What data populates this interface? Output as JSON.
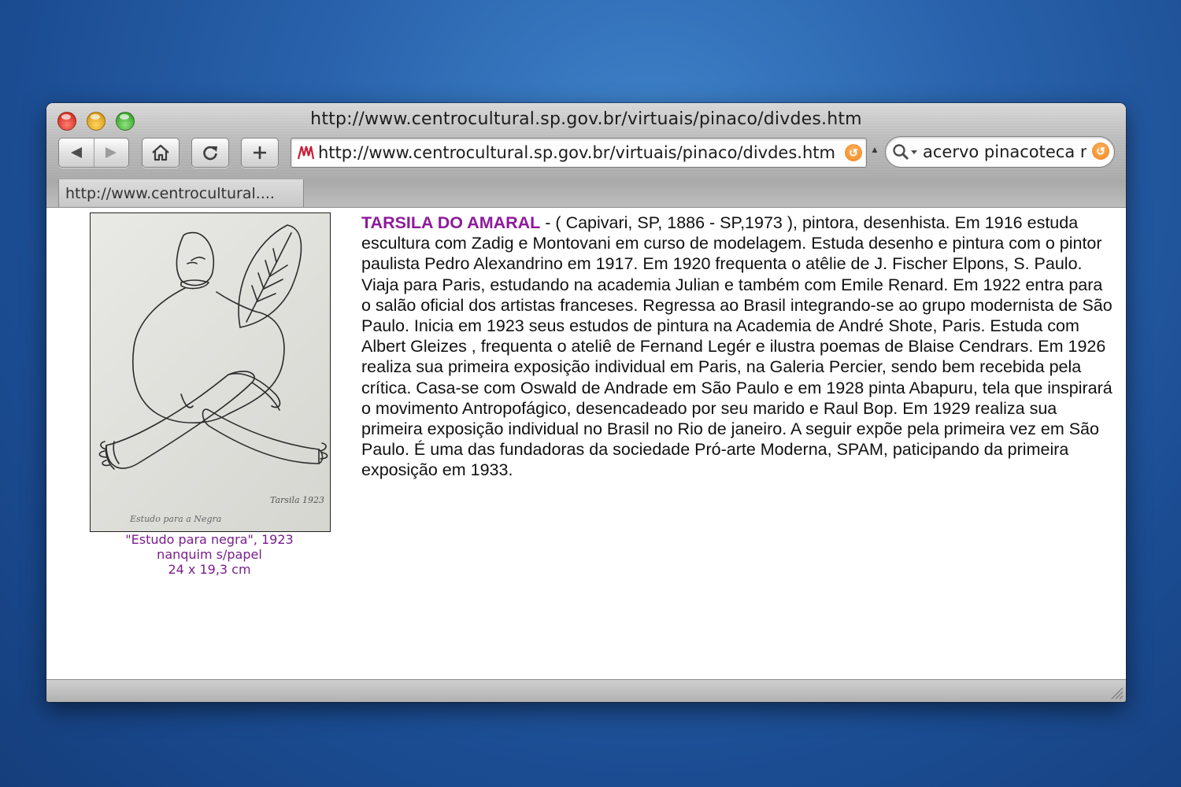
{
  "window": {
    "title": "http://www.centrocultural.sp.gov.br/virtuais/pinaco/divdes.htm"
  },
  "toolbar": {
    "address_value": "http://www.centrocultural.sp.gov.br/virtuais/pinaco/divdes.htm",
    "search_value": "acervo pinacoteca m"
  },
  "tabs": [
    {
      "label": "http://www.centrocultural...."
    }
  ],
  "artwork": {
    "caption_line1": "\"Estudo para negra\", 1923",
    "caption_line2": "nanquim s/papel",
    "caption_line3": "24 x 19,3 cm",
    "inscription_signature": "Tarsila 1923",
    "inscription_title": "Estudo para a Negra"
  },
  "bio": {
    "name": "TARSILA DO AMARAL",
    "text": " - ( Capivari, SP, 1886 - SP,1973 ), pintora, desenhista. Em 1916 estuda escultura com Zadig e Montovani em curso de modelagem. Estuda desenho e pintura com o pintor paulista Pedro Alexandrino em 1917. Em 1920 frequenta o atêlie de J. Fischer Elpons, S. Paulo. Viaja para Paris, estudando na academia Julian e também com Emile Renard. Em 1922 entra para o salão oficial dos artistas franceses. Regressa ao Brasil integrando-se ao grupo modernista de São Paulo. Inicia em 1923 seus estudos de pintura na Academia de André Shote, Paris. Estuda com Albert Gleizes , frequenta o ateliê de Fernand Legér e ilustra poemas de Blaise Cendrars. Em 1926 realiza sua primeira exposição individual em Paris, na Galeria Percier, sendo bem recebida pela crítica. Casa-se com Oswald de Andrade em São Paulo e em 1928 pinta Abapuru, tela que inspirará o movimento Antropofágico, desencadeado por seu marido e Raul Bop. Em 1929 realiza sua primeira exposição individual no Brasil no Rio de janeiro. A seguir expõe pela primeira vez em São Paulo. É uma das fundadoras da sociedade Pró-arte Moderna, SPAM, paticipando da primeira exposição em 1933."
  },
  "colors": {
    "accent_name": "#8e1a9c",
    "caption": "#7a1e8c",
    "desktop": "#2a64ad"
  },
  "icons": [
    "close-light",
    "minimize-light",
    "zoom-light",
    "back-arrow-icon",
    "forward-arrow-icon",
    "home-icon",
    "reload-icon",
    "plus-icon",
    "site-favicon",
    "snapback-icon",
    "magnifier-icon",
    "resize-grip-icon"
  ]
}
